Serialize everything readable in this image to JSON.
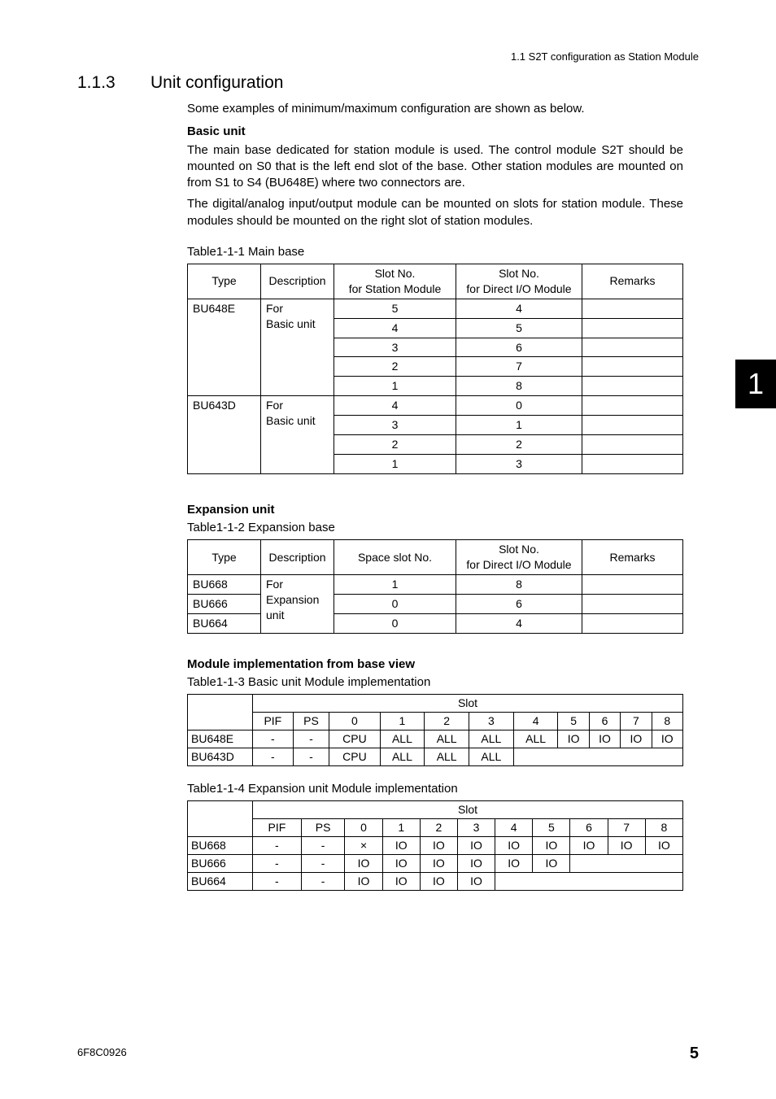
{
  "header": {
    "right": "1.1  S2T configuration as Station Module"
  },
  "section": {
    "num": "1.1.3",
    "title": "Unit configuration"
  },
  "intro": "Some examples of minimum/maximum configuration are shown as below.",
  "basic_unit": {
    "heading": "Basic unit",
    "p1": "The main base dedicated for station module is used. The control module S2T should be mounted on S0 that is the left end slot of the base. Other station modules are mounted on from S1 to S4 (BU648E) where two connectors are.",
    "p2": "The digital/analog input/output module can be mounted on slots for station module. These modules should be mounted on the right slot of station modules."
  },
  "table1": {
    "caption": "Table1-1-1  Main base",
    "headers": [
      "Type",
      "Description",
      "Slot No.\nfor Station Module",
      "Slot No.\nfor Direct I/O Module",
      "Remarks"
    ],
    "groups": [
      {
        "type": "BU648E",
        "desc": "For\nBasic unit",
        "rows": [
          [
            "5",
            "4",
            ""
          ],
          [
            "4",
            "5",
            ""
          ],
          [
            "3",
            "6",
            ""
          ],
          [
            "2",
            "7",
            ""
          ],
          [
            "1",
            "8",
            ""
          ]
        ]
      },
      {
        "type": "BU643D",
        "desc": "For\nBasic unit",
        "rows": [
          [
            "4",
            "0",
            ""
          ],
          [
            "3",
            "1",
            ""
          ],
          [
            "2",
            "2",
            ""
          ],
          [
            "1",
            "3",
            ""
          ]
        ]
      }
    ]
  },
  "expansion": {
    "heading": "Expansion unit"
  },
  "table2": {
    "caption": "Table1-1-2  Expansion base",
    "headers": [
      "Type",
      "Description",
      "Space slot No.",
      "Slot No.\nfor Direct I/O Module",
      "Remarks"
    ],
    "desc": "For\nExpansion\nunit",
    "rows": [
      [
        "BU668",
        "1",
        "8",
        ""
      ],
      [
        "BU666",
        "0",
        "6",
        ""
      ],
      [
        "BU664",
        "0",
        "4",
        ""
      ]
    ]
  },
  "module_impl_heading": "Module implementation from base view",
  "table3": {
    "caption": "Table1-1-3  Basic unit Module implementation",
    "slot_label": "Slot",
    "cols": [
      "PIF",
      "PS",
      "0",
      "1",
      "2",
      "3",
      "4",
      "5",
      "6",
      "7",
      "8"
    ],
    "rows": [
      {
        "type": "BU648E",
        "cells": [
          "-",
          "-",
          "CPU",
          "ALL",
          "ALL",
          "ALL",
          "ALL",
          "IO",
          "IO",
          "IO",
          "IO"
        ]
      },
      {
        "type": "BU643D",
        "cells": [
          "-",
          "-",
          "CPU",
          "ALL",
          "ALL",
          "ALL",
          "",
          "",
          "",
          "",
          ""
        ]
      }
    ]
  },
  "table4": {
    "caption": "Table1-1-4  Expansion unit Module implementation",
    "slot_label": "Slot",
    "cols": [
      "PIF",
      "PS",
      "0",
      "1",
      "2",
      "3",
      "4",
      "5",
      "6",
      "7",
      "8"
    ],
    "rows": [
      {
        "type": "BU668",
        "cells": [
          "-",
          "-",
          "×",
          "IO",
          "IO",
          "IO",
          "IO",
          "IO",
          "IO",
          "IO",
          "IO"
        ]
      },
      {
        "type": "BU666",
        "cells": [
          "-",
          "-",
          "IO",
          "IO",
          "IO",
          "IO",
          "IO",
          "IO",
          "",
          "",
          ""
        ]
      },
      {
        "type": "BU664",
        "cells": [
          "-",
          "-",
          "IO",
          "IO",
          "IO",
          "IO",
          "",
          "",
          "",
          "",
          ""
        ]
      }
    ]
  },
  "chapter_tab": "1",
  "footer": {
    "left": "6F8C0926",
    "right": "5"
  }
}
